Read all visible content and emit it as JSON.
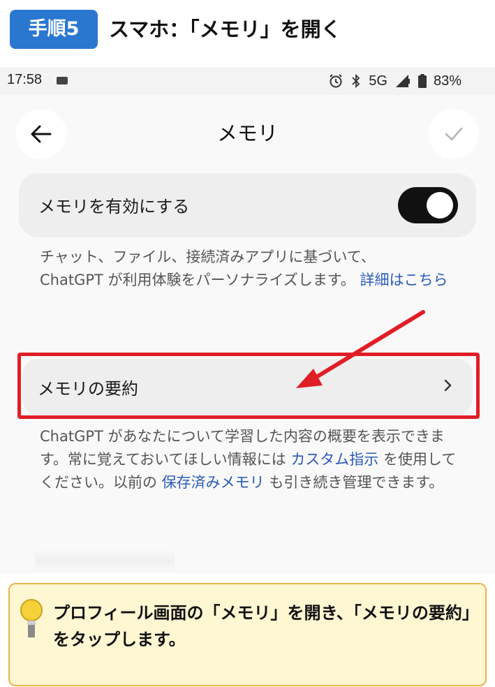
{
  "step": {
    "badge": "手順5",
    "title": "スマホ：「メモリ」を開く"
  },
  "status_bar": {
    "time": "17:58",
    "network": "5G",
    "battery": "83%"
  },
  "header": {
    "title": "メモリ",
    "back_icon": "back-arrow-icon",
    "confirm_icon": "check-icon"
  },
  "memory_toggle": {
    "label": "メモリを有効にする",
    "enabled": true
  },
  "memory_description": {
    "text_line1": "チャット、ファイル、接続済みアプリに基づいて、",
    "text_line2": "ChatGPT が利用体験をパーソナライズします。",
    "link": "詳細はこちら"
  },
  "memory_summary": {
    "label": "メモリの要約"
  },
  "summary_description": {
    "part1": "ChatGPT があなたについて学習した内容の概要を表示できます。常に覚えておいてほしい情報には",
    "link1": "カスタム指示",
    "part2": "を使用してください。以前の",
    "link2": "保存済みメモリ",
    "part3": "も引き続き管理できます。"
  },
  "tip": {
    "text": "プロフィール画面の「メモリ」を開き、「メモリの要約」をタップします。",
    "icon": "lightbulb-icon"
  },
  "colors": {
    "badge": "#2a77d0",
    "highlight": "#e01e25",
    "link": "#2a5bb8",
    "tip_bg": "#fff6d2",
    "tip_border": "#e8b54a"
  }
}
